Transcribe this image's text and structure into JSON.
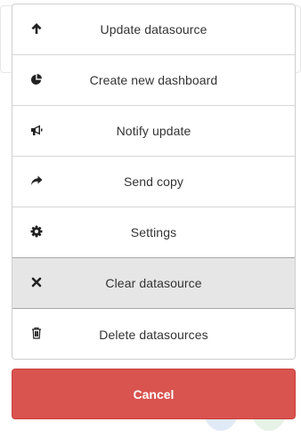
{
  "actions": [
    {
      "label": "Update datasource",
      "icon": "arrow-up-icon",
      "name": "update-datasource-button"
    },
    {
      "label": "Create new dashboard",
      "icon": "pie-chart-icon",
      "name": "create-dashboard-button"
    },
    {
      "label": "Notify update",
      "icon": "bullhorn-icon",
      "name": "notify-update-button"
    },
    {
      "label": "Send copy",
      "icon": "share-arrow-icon",
      "name": "send-copy-button"
    },
    {
      "label": "Settings",
      "icon": "gear-icon",
      "name": "settings-button"
    },
    {
      "label": "Clear datasource",
      "icon": "close-icon",
      "name": "clear-datasource-button",
      "active": true
    },
    {
      "label": "Delete datasources",
      "icon": "trash-icon",
      "name": "delete-datasources-button"
    }
  ],
  "cancel": {
    "label": "Cancel"
  },
  "colors": {
    "cancel_bg": "#d9534f",
    "active_bg": "#e6e6e6",
    "text": "#333333"
  }
}
